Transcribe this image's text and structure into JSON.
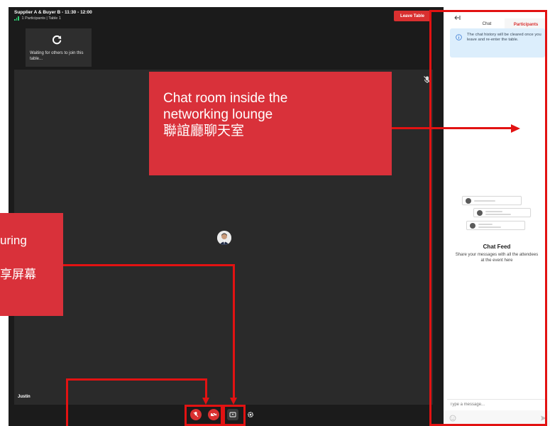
{
  "header": {
    "title": "Supplier A & Buyer B - 11:30 - 12:00",
    "subtitle": "1 Participants | Table 1"
  },
  "leave_button": "Leave Table",
  "waiting_tile": {
    "text": "Waiting for others to join this table..."
  },
  "main_video": {
    "participant_name": "Justin"
  },
  "controls": {
    "items": [
      "mic-off-icon",
      "camera-off-icon",
      "screen-share-icon",
      "settings-icon"
    ]
  },
  "chat_panel": {
    "tabs": [
      {
        "label": "Chat",
        "active": true
      },
      {
        "label": "Participants",
        "active": false
      }
    ],
    "info_text": "The chat history will be cleared once you leave and re-enter the table.",
    "feed_title": "Chat Feed",
    "feed_subtitle": "Share your messages with all the attendees at the event here",
    "message_placeholder": "Type a message..."
  },
  "annotations": {
    "chat_callout": {
      "line1": "Chat room inside the",
      "line2": "networking lounge",
      "line3": "聯誼廳聊天室"
    },
    "left_callout": {
      "line1": "uring",
      "line2": "享屏幕"
    }
  },
  "colors": {
    "dark_bg": "#1b1b1b",
    "video_bg": "#2a2a2a",
    "accent_red": "#d93030",
    "annotation_red": "#e21212",
    "info_bg": "#dceefc"
  }
}
